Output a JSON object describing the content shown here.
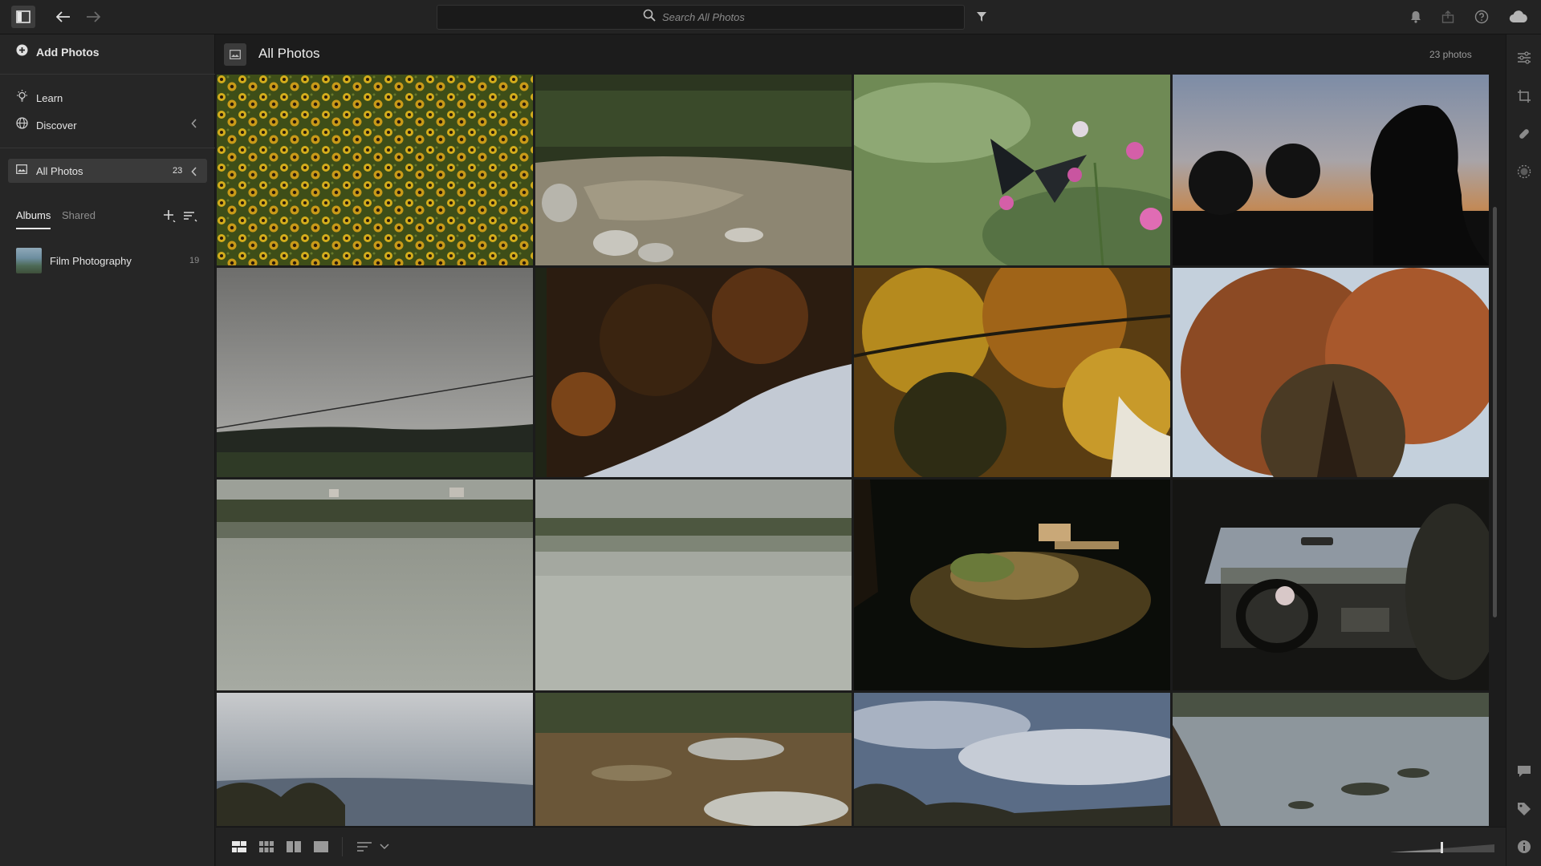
{
  "topbar": {
    "search_placeholder": "Search All Photos",
    "icons": [
      "sidebar-toggle-icon",
      "back-arrow-icon",
      "forward-arrow-icon",
      "search-icon",
      "filter-icon",
      "bell-icon",
      "share-icon",
      "help-icon",
      "cloud-icon"
    ]
  },
  "sidebar": {
    "add_photos": "Add Photos",
    "learn": "Learn",
    "discover": "Discover",
    "all_photos": {
      "label": "All Photos",
      "count": "23"
    },
    "tabs": {
      "albums": "Albums",
      "shared": "Shared"
    },
    "albums": [
      {
        "name": "Film Photography",
        "count": "19"
      }
    ]
  },
  "main": {
    "title": "All Photos",
    "photo_count": "23 photos",
    "photos": [
      {
        "subject": "field of black-eyed susans",
        "colors": [
          "#6b6a1e",
          "#c9a61a",
          "#3d4a1a"
        ]
      },
      {
        "subject": "creek with rocks in shade",
        "colors": [
          "#2e3a22",
          "#8a8470",
          "#3b3a2a"
        ]
      },
      {
        "subject": "butterfly on pink flower",
        "colors": [
          "#6d8a55",
          "#9bb27a",
          "#c06aa0"
        ]
      },
      {
        "subject": "silhouette at sunset",
        "colors": [
          "#8594ac",
          "#b78a5e",
          "#0f0f0f"
        ]
      },
      {
        "subject": "overcast sky over field",
        "colors": [
          "#8d8d8b",
          "#a9a9a6",
          "#2b2e24"
        ]
      },
      {
        "subject": "autumn tree from below",
        "colors": [
          "#2d1e12",
          "#7a4418",
          "#b8c0cc"
        ]
      },
      {
        "subject": "yellow maple canopy",
        "colors": [
          "#b88a1e",
          "#5a3d12",
          "#2a2a14"
        ]
      },
      {
        "subject": "orange tree against sky",
        "colors": [
          "#a2522a",
          "#c0ccd8",
          "#4a3a24"
        ]
      },
      {
        "subject": "lake reflection with shoreline",
        "colors": [
          "#7a7e74",
          "#9a9e94",
          "#3a4230"
        ]
      },
      {
        "subject": "misty lake treeline",
        "colors": [
          "#9da19a",
          "#b2b6ae",
          "#4a5240"
        ]
      },
      {
        "subject": "night scene with bench",
        "colors": [
          "#0c0e0a",
          "#7a6a3a",
          "#c9b07a"
        ]
      },
      {
        "subject": "car interior driving",
        "colors": [
          "#1a1a18",
          "#8f98a2",
          "#3a3a34"
        ]
      },
      {
        "subject": "cloudy valley view",
        "colors": [
          "#a2a6ac",
          "#7a8490",
          "#3a3a2e"
        ]
      },
      {
        "subject": "rocky dry grass",
        "colors": [
          "#6e5a3c",
          "#b3b3aa",
          "#4a5236"
        ]
      },
      {
        "subject": "blue sky with clouds",
        "colors": [
          "#5c6e88",
          "#c2c8d2",
          "#3a3f34"
        ]
      },
      {
        "subject": "winter river stones",
        "colors": [
          "#8e969c",
          "#4a5248",
          "#2a2e26"
        ]
      }
    ]
  },
  "bottombar": {
    "icons": [
      "view-photo-grid-icon",
      "view-square-grid-icon",
      "view-compare-icon",
      "view-detail-icon",
      "sort-icon",
      "sort-chevron-icon",
      "thumbnail-size-slider"
    ]
  },
  "rail": {
    "icons": [
      "edit-sliders-icon",
      "crop-icon",
      "healing-icon",
      "masking-icon",
      "comment-icon",
      "tag-icon",
      "info-icon"
    ]
  }
}
